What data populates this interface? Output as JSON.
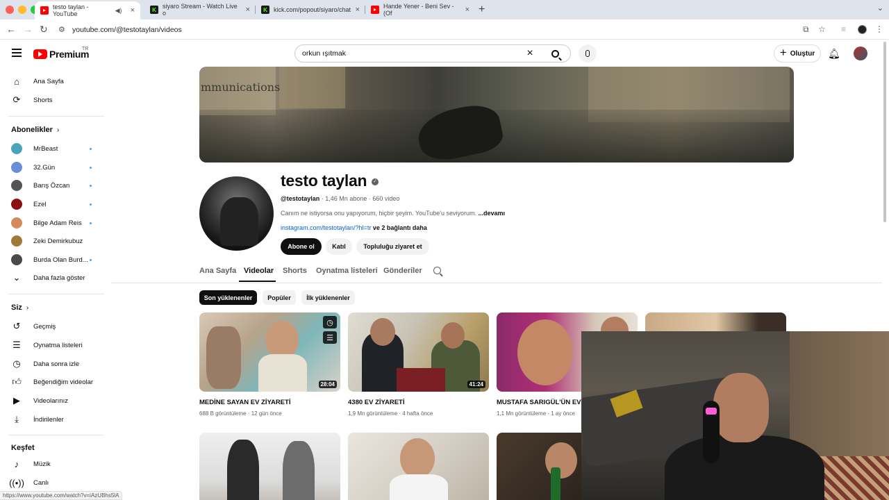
{
  "browser": {
    "tabs": [
      {
        "title": "testo taylan - YouTube",
        "favicon": "youtube-icon",
        "active": true
      },
      {
        "title": "siyaro Stream - Watch Live o",
        "favicon": "kick-icon"
      },
      {
        "title": "kick.com/popout/siyaro/chat",
        "favicon": "kick-icon"
      },
      {
        "title": "Hande Yener - Beni Sev - (Of",
        "favicon": "youtube-icon"
      }
    ],
    "url": "youtube.com/@testotaylan/videos",
    "status_url": "https://www.youtube.com/watch?v=iAzUBhs5lA"
  },
  "masthead": {
    "logo": "Premium",
    "country": "TR",
    "search_value": "orkun ışıtmak",
    "create_label": "Oluştur"
  },
  "sidebar": {
    "main": [
      {
        "label": "Ana Sayfa",
        "icon": "home-icon"
      },
      {
        "label": "Shorts",
        "icon": "shorts-icon"
      }
    ],
    "subscriptions_header": "Abonelikler",
    "subscriptions": [
      {
        "label": "MrBeast",
        "color": "#4aa3b8",
        "new": true
      },
      {
        "label": "32.Gün",
        "color": "#6b8fd6",
        "new": true
      },
      {
        "label": "Barış Özcan",
        "color": "#555555",
        "new": true
      },
      {
        "label": "Ezel",
        "color": "#8b1010",
        "new": true
      },
      {
        "label": "Bilge Adam Reis",
        "color": "#d48a5a",
        "new": true
      },
      {
        "label": "Zeki Demirkubuz",
        "color": "#a0783a",
        "new": false
      },
      {
        "label": "Burda Olan Burd...",
        "color": "#4a4a4a",
        "new": true
      }
    ],
    "show_more": "Daha fazla göster",
    "you_header": "Siz",
    "you": [
      {
        "label": "Geçmiş",
        "icon": "history-icon"
      },
      {
        "label": "Oynatma listeleri",
        "icon": "playlist-icon"
      },
      {
        "label": "Daha sonra izle",
        "icon": "clock-icon"
      },
      {
        "label": "Beğendiğim videolar",
        "icon": "like-icon"
      },
      {
        "label": "Videolarınız",
        "icon": "video-icon"
      },
      {
        "label": "İndirilenler",
        "icon": "download-icon"
      }
    ],
    "explore_header": "Keşfet",
    "explore": [
      {
        "label": "Müzik",
        "icon": "music-icon"
      },
      {
        "label": "Canlı",
        "icon": "live-icon"
      }
    ]
  },
  "channel": {
    "banner_text": "mmunications",
    "name": "testo taylan",
    "handle": "@testotaylan",
    "subs": " · 1,46 Mn abone · 660 video",
    "description": "Canım ne istiyorsa onu yapıyorum, hiçbir şeyim. YouTube'u seviyorum. ",
    "more": "...devamı",
    "link": "instagram.com/testotaylan/?hl=tr",
    "link_more": " ve 2 bağlantı daha",
    "subscribe": "Abone ol",
    "join": "Katıl",
    "community": "Topluluğu ziyaret et"
  },
  "tabs": [
    "Ana Sayfa",
    "Videolar",
    "Shorts",
    "Oynatma listeleri",
    "Gönderiler"
  ],
  "active_tab": "Videolar",
  "chips": [
    "Son yüklenenler",
    "Popüler",
    "İlk yüklenenler"
  ],
  "videos": [
    {
      "title": "MEDİNE SAYAN EV ZİYARETİ",
      "meta": "688 B görüntüleme · 12 gün önce",
      "duration": "28:04"
    },
    {
      "title": "4380 EV ZİYARETİ",
      "meta": "1,9 Mn görüntüleme · 4 hafta önce",
      "duration": "41:24"
    },
    {
      "title": "MUSTAFA SARIGÜL'ÜN EVİNDE",
      "meta": "1,1 Mn görüntüleme · 1 ay önce",
      "duration": ""
    }
  ]
}
